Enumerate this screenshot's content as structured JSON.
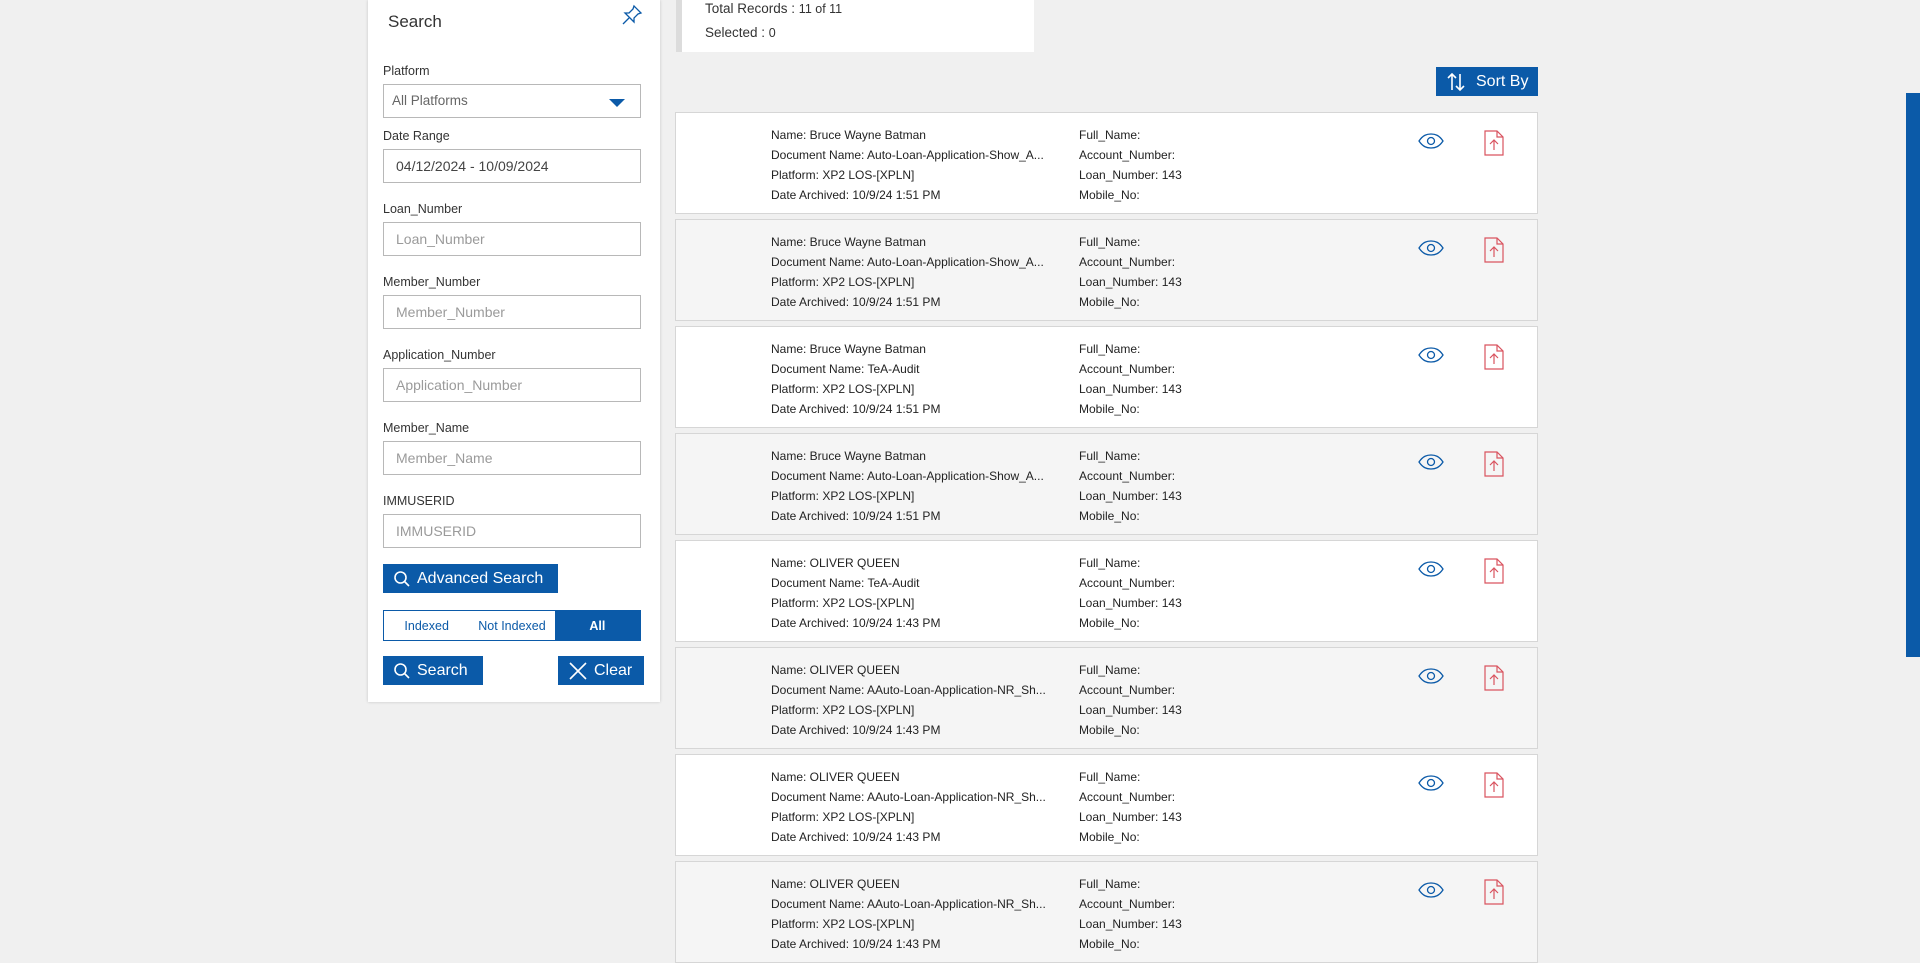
{
  "search": {
    "title": "Search",
    "platform_label": "Platform",
    "platform_value": "All Platforms",
    "date_range_label": "Date Range",
    "date_range_value": "04/12/2024 - 10/09/2024",
    "fields": [
      {
        "label": "Loan_Number",
        "placeholder": "Loan_Number"
      },
      {
        "label": "Member_Number",
        "placeholder": "Member_Number"
      },
      {
        "label": "Application_Number",
        "placeholder": "Application_Number"
      },
      {
        "label": "Member_Name",
        "placeholder": "Member_Name"
      },
      {
        "label": "IMMUSERID",
        "placeholder": "IMMUSERID"
      }
    ],
    "advanced_search_label": "Advanced Search",
    "index_filter": {
      "options": [
        "Indexed",
        "Not Indexed",
        "All"
      ],
      "selected": "All"
    },
    "search_button_label": "Search",
    "clear_button_label": "Clear"
  },
  "summary": {
    "total_records_label": "Total Records : ",
    "total_records_value": "11 of 11",
    "selected_label": "Selected : ",
    "selected_value": "0"
  },
  "sort_label": "Sort By",
  "records": [
    {
      "name": "Name: Bruce Wayne Batman",
      "document": "Document Name: Auto-Loan-Application-Show_A...",
      "platform": "Platform: XP2 LOS-[XPLN]",
      "archived": "Date Archived: 10/9/24 1:51 PM",
      "full_name": "Full_Name:",
      "account": "Account_Number:",
      "loan": "Loan_Number: 143",
      "mobile": "Mobile_No:"
    },
    {
      "name": "Name: Bruce Wayne Batman",
      "document": "Document Name: Auto-Loan-Application-Show_A...",
      "platform": "Platform: XP2 LOS-[XPLN]",
      "archived": "Date Archived: 10/9/24 1:51 PM",
      "full_name": "Full_Name:",
      "account": "Account_Number:",
      "loan": "Loan_Number: 143",
      "mobile": "Mobile_No:"
    },
    {
      "name": "Name: Bruce Wayne Batman",
      "document": "Document Name: TeA-Audit",
      "platform": "Platform: XP2 LOS-[XPLN]",
      "archived": "Date Archived: 10/9/24 1:51 PM",
      "full_name": "Full_Name:",
      "account": "Account_Number:",
      "loan": "Loan_Number: 143",
      "mobile": "Mobile_No:"
    },
    {
      "name": "Name: Bruce Wayne Batman",
      "document": "Document Name: Auto-Loan-Application-Show_A...",
      "platform": "Platform: XP2 LOS-[XPLN]",
      "archived": "Date Archived: 10/9/24 1:51 PM",
      "full_name": "Full_Name:",
      "account": "Account_Number:",
      "loan": "Loan_Number: 143",
      "mobile": "Mobile_No:"
    },
    {
      "name": "Name: OLIVER QUEEN",
      "document": "Document Name: TeA-Audit",
      "platform": "Platform: XP2 LOS-[XPLN]",
      "archived": "Date Archived: 10/9/24 1:43 PM",
      "full_name": "Full_Name:",
      "account": "Account_Number:",
      "loan": "Loan_Number: 143",
      "mobile": "Mobile_No:"
    },
    {
      "name": "Name: OLIVER QUEEN",
      "document": "Document Name: AAuto-Loan-Application-NR_Sh...",
      "platform": "Platform: XP2 LOS-[XPLN]",
      "archived": "Date Archived: 10/9/24 1:43 PM",
      "full_name": "Full_Name:",
      "account": "Account_Number:",
      "loan": "Loan_Number: 143",
      "mobile": "Mobile_No:"
    },
    {
      "name": "Name: OLIVER QUEEN",
      "document": "Document Name: AAuto-Loan-Application-NR_Sh...",
      "platform": "Platform: XP2 LOS-[XPLN]",
      "archived": "Date Archived: 10/9/24 1:43 PM",
      "full_name": "Full_Name:",
      "account": "Account_Number:",
      "loan": "Loan_Number: 143",
      "mobile": "Mobile_No:"
    },
    {
      "name": "Name: OLIVER QUEEN",
      "document": "Document Name: AAuto-Loan-Application-NR_Sh...",
      "platform": "Platform: XP2 LOS-[XPLN]",
      "archived": "Date Archived: 10/9/24 1:43 PM",
      "full_name": "Full_Name:",
      "account": "Account_Number:",
      "loan": "Loan_Number: 143",
      "mobile": "Mobile_No:"
    }
  ],
  "icons": {
    "pin": "pin-icon",
    "dropdown": "chevron-down-icon",
    "search": "search-icon",
    "clear": "close-icon",
    "sort": "sort-icon",
    "view": "eye-icon",
    "pdf": "pdf-file-icon"
  },
  "colors": {
    "primary": "#0b5aa8",
    "pdf_icon": "#d9535f",
    "background": "#f0f0f0",
    "alt_row": "#f5f5f5"
  }
}
